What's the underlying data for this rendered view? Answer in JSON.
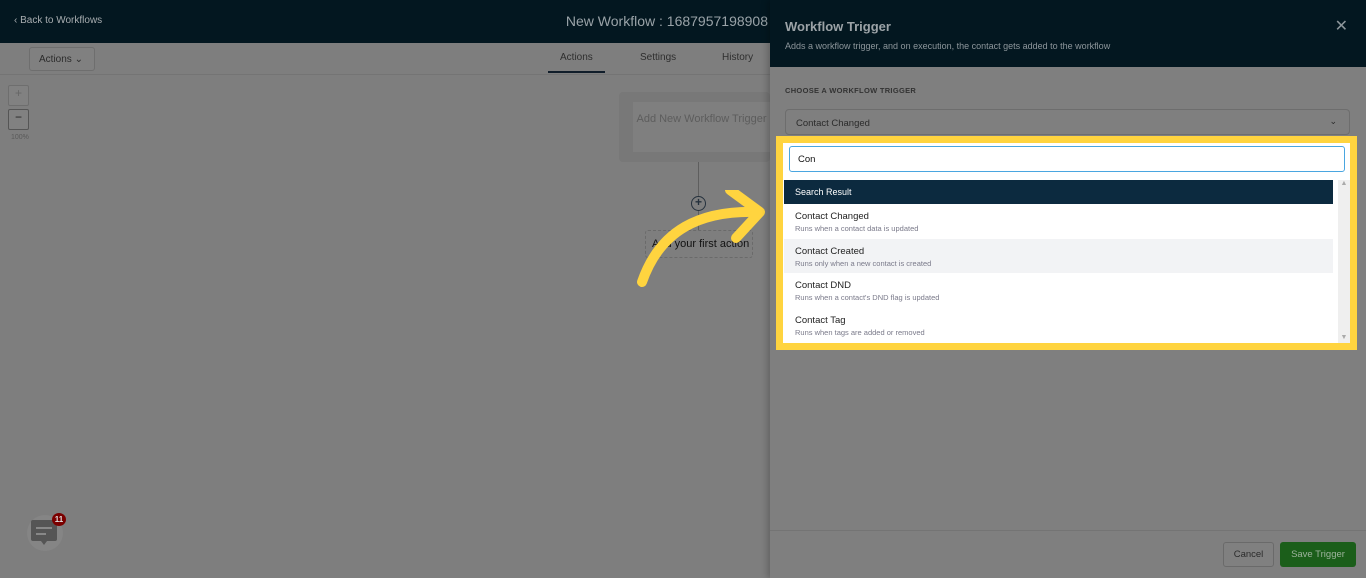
{
  "header": {
    "back_label": "Back to Workflows",
    "workflow_title": "New Workflow : 1687957198908"
  },
  "toolbar": {
    "actions_label": "Actions",
    "tabs": [
      {
        "label": "Actions",
        "active": true
      },
      {
        "label": "Settings"
      },
      {
        "label": "History"
      }
    ]
  },
  "canvas": {
    "zoom_in": "+",
    "zoom_out": "−",
    "zoom_level": "100%",
    "trigger_card": "Add New Workflow Trigger",
    "first_action": "Add your first action",
    "chat_badge": "11"
  },
  "drawer": {
    "title": "Workflow Trigger",
    "subtitle": "Adds a workflow trigger, and on execution, the contact gets added to the workflow",
    "section_label": "CHOOSE A WORKFLOW TRIGGER",
    "selected": "Contact Changed",
    "search_value": "Con",
    "results_header": "Search Result",
    "results": [
      {
        "title": "Contact Changed",
        "desc": "Runs when a contact data is updated"
      },
      {
        "title": "Contact Created",
        "desc": "Runs only when a new contact is created",
        "hovered": true
      },
      {
        "title": "Contact DND",
        "desc": "Runs when a contact's DND flag is updated"
      },
      {
        "title": "Contact Tag",
        "desc": "Runs when tags are added or removed"
      }
    ],
    "cancel_label": "Cancel",
    "save_label": "Save Trigger"
  },
  "colors": {
    "highlight": "#ffd43f",
    "header_bg": "#031720",
    "save_button": "#1b5e1a",
    "list_header": "#0c2a3f"
  }
}
